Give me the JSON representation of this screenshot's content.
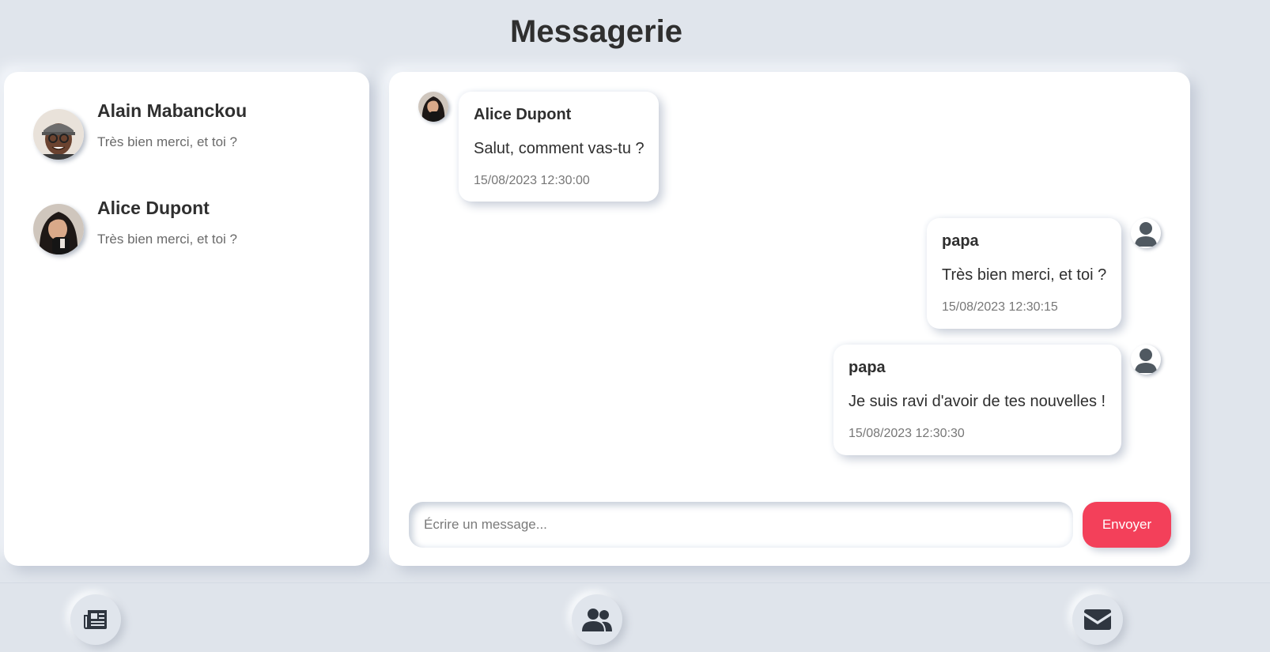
{
  "page": {
    "title": "Messagerie"
  },
  "contacts": [
    {
      "name": "Alain Mabanckou",
      "preview": "Très bien merci, et toi ?",
      "avatar_icon": "man-with-cap-photo"
    },
    {
      "name": "Alice Dupont",
      "preview": "Très bien merci, et toi ?",
      "avatar_icon": "woman-photo"
    }
  ],
  "messages": [
    {
      "author": "Alice Dupont",
      "text": "Salut, comment vas-tu ?",
      "time": "15/08/2023 12:30:00",
      "side": "left",
      "avatar_icon": "woman-photo"
    },
    {
      "author": "papa",
      "text": "Très bien merci, et toi ?",
      "time": "15/08/2023 12:30:15",
      "side": "right",
      "avatar_icon": "user-icon"
    },
    {
      "author": "papa",
      "text": "Je suis ravi d'avoir de tes nouvelles !",
      "time": "15/08/2023 12:30:30",
      "side": "right",
      "avatar_icon": "user-icon"
    }
  ],
  "composer": {
    "placeholder": "Écrire un message...",
    "value": "",
    "send_label": "Envoyer"
  },
  "nav": [
    {
      "icon": "newspaper-icon"
    },
    {
      "icon": "users-icon"
    },
    {
      "icon": "envelope-icon"
    }
  ],
  "colors": {
    "background": "#e0e5ec",
    "accent": "#f3405a",
    "panel": "#ffffff",
    "icon": "#2f3640"
  }
}
